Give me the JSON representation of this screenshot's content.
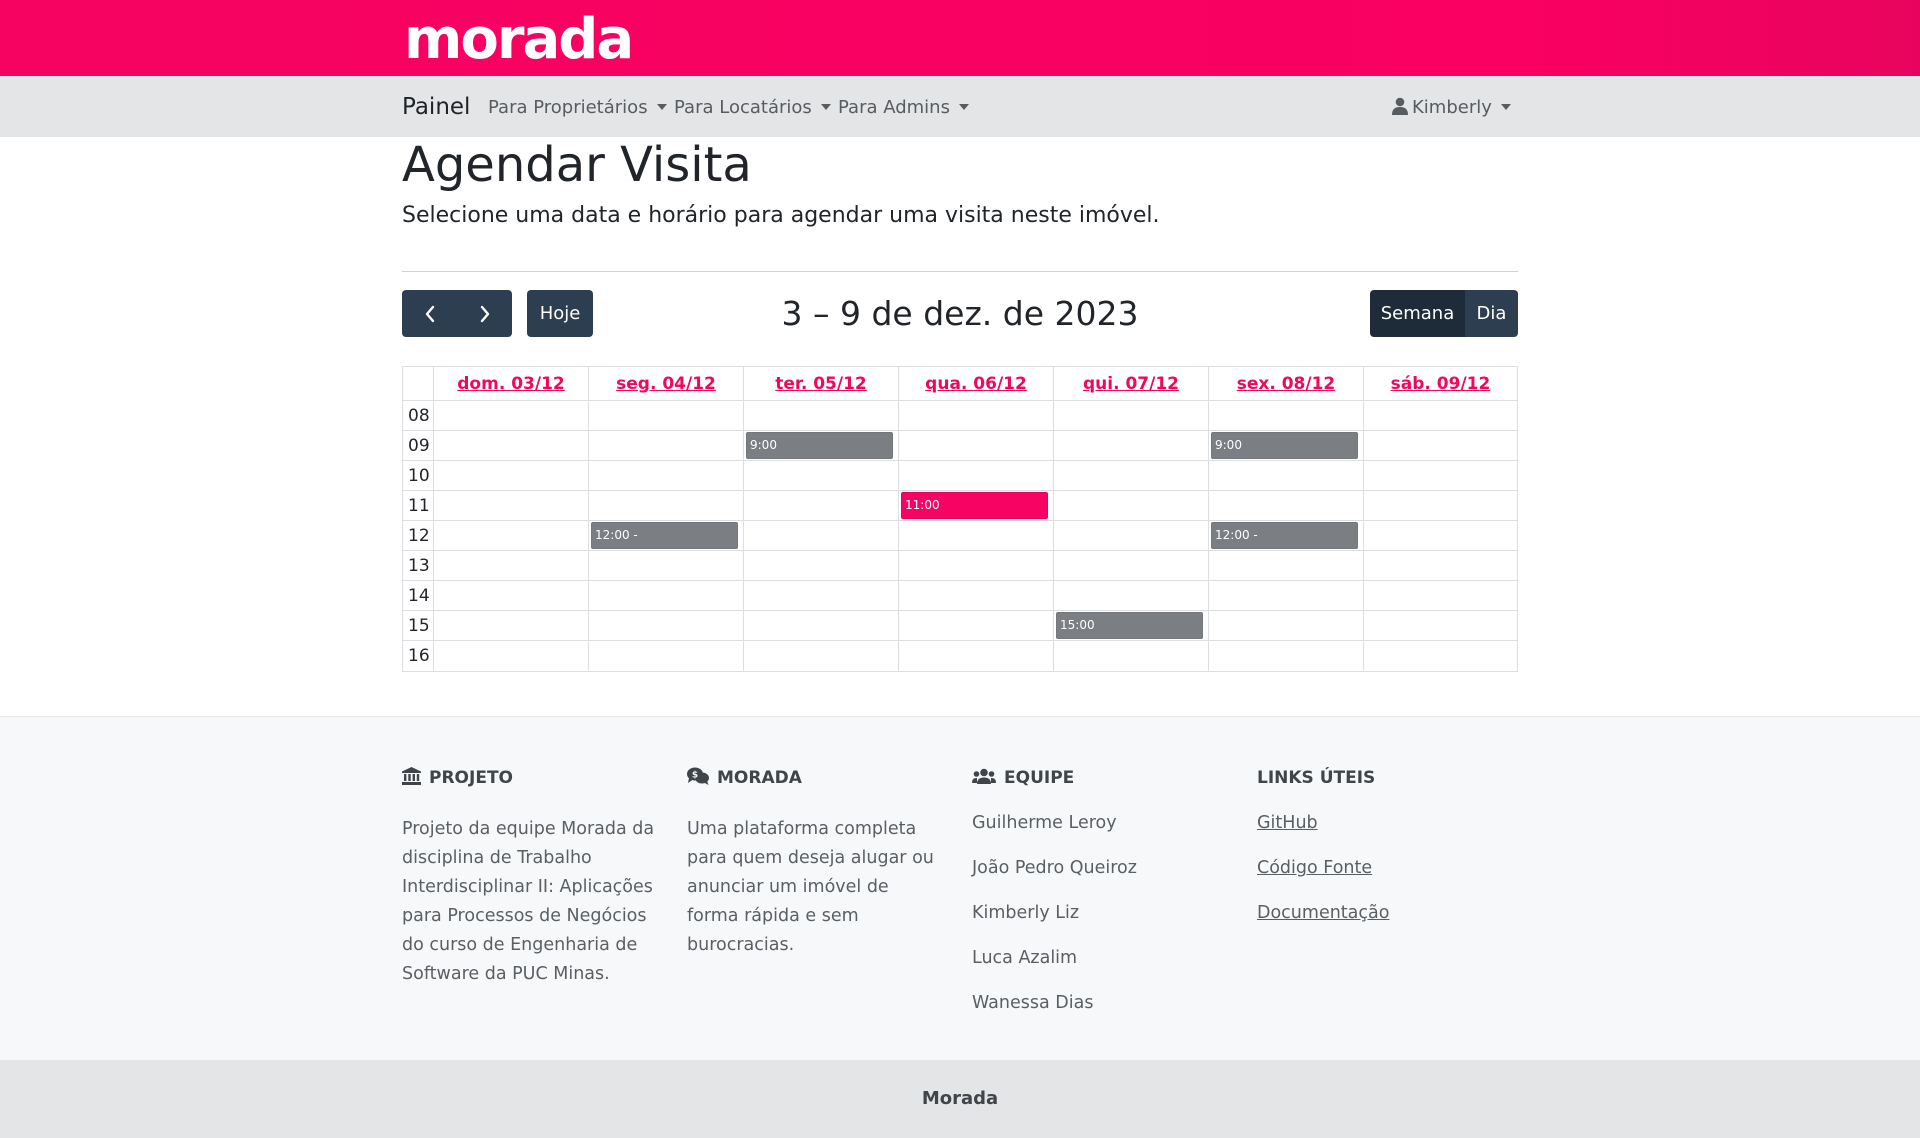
{
  "brand": {
    "name": "morada",
    "color": "#f60361"
  },
  "navbar": {
    "home": "Painel",
    "items": [
      {
        "label": "Para Proprietários"
      },
      {
        "label": "Para Locatários"
      },
      {
        "label": "Para Admins"
      }
    ],
    "user": "Kimberly",
    "user_icon": "user-icon"
  },
  "page": {
    "title": "Agendar Visita",
    "subtitle": "Selecione uma data e horário para agendar uma visita neste imóvel."
  },
  "toolbar": {
    "prev_icon": "chevron-left-icon",
    "next_icon": "chevron-right-icon",
    "today": "Hoje",
    "range": "3 – 9 de dez. de 2023",
    "views": [
      "Semana",
      "Dia"
    ],
    "active_view": "Semana"
  },
  "calendar": {
    "days": [
      "dom. 03/12",
      "seg. 04/12",
      "ter. 05/12",
      "qua. 06/12",
      "qui. 07/12",
      "sex. 08/12",
      "sáb. 09/12"
    ],
    "hours": [
      "08",
      "09",
      "10",
      "11",
      "12",
      "13",
      "14",
      "15",
      "16"
    ],
    "events": [
      {
        "day": 2,
        "hour": "09",
        "label": "9:00",
        "kind": "booked"
      },
      {
        "day": 5,
        "hour": "09",
        "label": "9:00",
        "kind": "booked"
      },
      {
        "day": 3,
        "hour": "11",
        "label": "11:00",
        "kind": "selected"
      },
      {
        "day": 1,
        "hour": "12",
        "label": "12:00 -",
        "kind": "booked"
      },
      {
        "day": 5,
        "hour": "12",
        "label": "12:00 -",
        "kind": "booked"
      },
      {
        "day": 4,
        "hour": "15",
        "label": "15:00",
        "kind": "booked"
      }
    ],
    "colors": {
      "booked": "#7b7e82",
      "selected": "#f60363",
      "day_header": "#f0075f"
    }
  },
  "footer": {
    "projeto": {
      "icon": "bank-icon",
      "title": "PROJETO",
      "text": "Projeto da equipe Morada da disciplina de Trabalho Interdisciplinar II: Aplicações para Processos de Negócios do curso de Engenharia de Software da PUC Minas."
    },
    "morada": {
      "icon": "chat-money-icon",
      "title": "MORADA",
      "text": "Uma plataforma completa para quem deseja alugar ou anunciar um imóvel de forma rápida e sem burocracias."
    },
    "equipe": {
      "icon": "users-icon",
      "title": "EQUIPE",
      "members": [
        "Guilherme Leroy",
        "João Pedro Queiroz",
        "Kimberly Liz",
        "Luca Azalim",
        "Wanessa Dias"
      ]
    },
    "links": {
      "title": "LINKS ÚTEIS",
      "items": [
        "GitHub",
        "Código Fonte",
        "Documentação"
      ]
    },
    "bottom": "Morada"
  }
}
